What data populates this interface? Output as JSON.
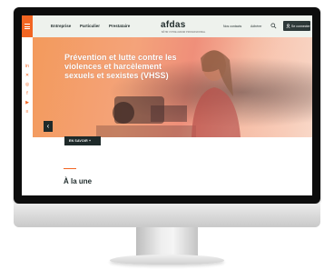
{
  "header": {
    "nav": [
      "Entreprise",
      "Particulier",
      "Prestataire"
    ],
    "logo": "afdas",
    "tagline": "BÂTIR VOTRE AVENIR PROFESSIONNEL",
    "utility_links": [
      "Nos contacts",
      "Adhérer"
    ],
    "login_label": "Se connecter"
  },
  "hero": {
    "title": "Prévention et lutte contre les violences et harcèlement sexuels et sexistes (VHSS)",
    "cta_label": "EN SAVOIR +"
  },
  "social_icons": [
    "linkedin-icon",
    "x-icon",
    "instagram-icon",
    "facebook-icon",
    "youtube-icon",
    "menu-bars-icon"
  ],
  "section": {
    "title": "À la une"
  },
  "colors": {
    "accent": "#f26522",
    "dark": "#1e2a2a",
    "header_bg": "#eef2ed"
  }
}
